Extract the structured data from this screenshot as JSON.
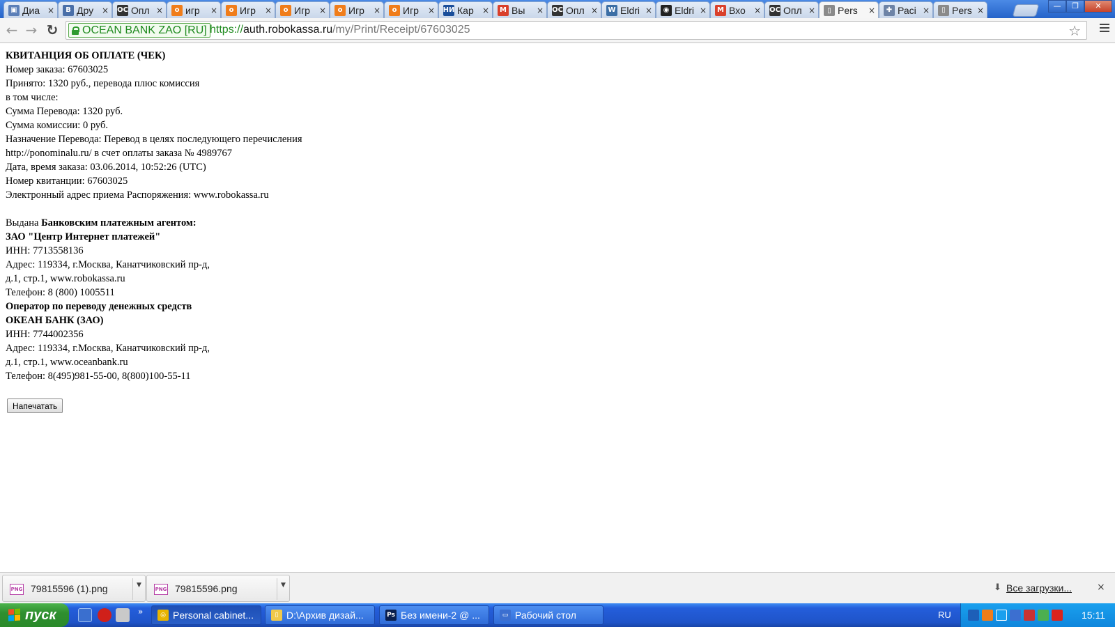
{
  "browser": {
    "tabs": [
      {
        "title": "Диа",
        "fav_color": "#5b7fb8",
        "fav_glyph": "▣"
      },
      {
        "title": "Дру",
        "fav_color": "#4a6fa8",
        "fav_glyph": "B"
      },
      {
        "title": "Опл",
        "fav_color": "#333333",
        "fav_glyph": "ОС"
      },
      {
        "title": "игр",
        "fav_color": "#f07d1a",
        "fav_glyph": "о"
      },
      {
        "title": "Игр",
        "fav_color": "#f07d1a",
        "fav_glyph": "о"
      },
      {
        "title": "Игр",
        "fav_color": "#f07d1a",
        "fav_glyph": "о"
      },
      {
        "title": "Игр",
        "fav_color": "#f07d1a",
        "fav_glyph": "о"
      },
      {
        "title": "Игр",
        "fav_color": "#f07d1a",
        "fav_glyph": "о"
      },
      {
        "title": "Кар",
        "fav_color": "#1a4e9a",
        "fav_glyph": "НИ"
      },
      {
        "title": "Вы",
        "fav_color": "#d9402b",
        "fav_glyph": "M"
      },
      {
        "title": "Опл",
        "fav_color": "#333333",
        "fav_glyph": "ОС"
      },
      {
        "title": "Eldri",
        "fav_color": "#3b6ea5",
        "fav_glyph": "W"
      },
      {
        "title": "Eldri",
        "fav_color": "#222222",
        "fav_glyph": "◉"
      },
      {
        "title": "Вхо",
        "fav_color": "#d9402b",
        "fav_glyph": "M"
      },
      {
        "title": "Опл",
        "fav_color": "#333333",
        "fav_glyph": "ОС"
      },
      {
        "title": "Pers",
        "fav_color": "#8a8a8a",
        "fav_glyph": "▯",
        "active": true
      },
      {
        "title": "Расі",
        "fav_color": "#6d83a6",
        "fav_glyph": "✚"
      },
      {
        "title": "Pers",
        "fav_color": "#8a8a8a",
        "fav_glyph": "▯"
      }
    ],
    "tab_close_glyph": "×",
    "window_buttons": [
      "—",
      "❐",
      "✕"
    ],
    "nav": {
      "back": "←",
      "forward": "→",
      "reload": "↻"
    },
    "address_bar": {
      "ev_label": "OCEAN BANK ZAO [RU]",
      "url_scheme": "https://",
      "url_host": "auth.robokassa.ru",
      "url_path": "/my/Print/Receipt/67603025",
      "star_glyph": "☆"
    }
  },
  "receipt": {
    "lines": [
      {
        "text": "КВИТАНЦИЯ ОБ ОПЛАТЕ (ЧЕК)",
        "bold": true
      },
      {
        "text": "Номер заказа: 67603025"
      },
      {
        "text": "Принято: 1320 руб., перевода плюс комиссия"
      },
      {
        "text": "в том числе:"
      },
      {
        "text": "Сумма Перевода: 1320 руб."
      },
      {
        "text": "Сумма комиссии: 0 руб."
      },
      {
        "text": "Назначение Перевода: Перевод в целях последующего перечисления"
      },
      {
        "text": "http://ponominalu.ru/ в счет оплаты заказа № 4989767"
      },
      {
        "text": "Дата, время заказа: 03.06.2014, 10:52:26 (UTC)"
      },
      {
        "text": "Номер квитанции: 67603025"
      },
      {
        "text": "Электронный адрес приема Распоряжения: www.robokassa.ru"
      },
      {
        "text": ""
      },
      {
        "text": "Выдана ",
        "bold_suffix": "Банковским платежным агентом:"
      },
      {
        "text": "ЗАО \"Центр Интернет платежей\"",
        "bold": true
      },
      {
        "text": "ИНН: 7713558136"
      },
      {
        "text": "Адрес: 119334, г.Москва, Канатчиковский пр-д,"
      },
      {
        "text": "д.1, стр.1, www.robokassa.ru"
      },
      {
        "text": "Телефон: 8 (800) 1005511"
      },
      {
        "text": "Оператор по переводу денежных средств",
        "bold": true
      },
      {
        "text": "ОКЕАН БАНК (ЗАО)",
        "bold": true
      },
      {
        "text": "ИНН: 7744002356"
      },
      {
        "text": "Адрес: 119334, г.Москва, Канатчиковский пр-д,"
      },
      {
        "text": "д.1, стр.1, www.oceanbank.ru"
      },
      {
        "text": "Телефон: 8(495)981-55-00, 8(800)100-55-11"
      }
    ],
    "print_button_label": "Напечатать"
  },
  "downloads": {
    "items": [
      {
        "file_name": "79815596 (1).png",
        "icon_label": "PNG"
      },
      {
        "file_name": "79815596.png",
        "icon_label": "PNG"
      }
    ],
    "all_downloads_label": "Все загрузки...",
    "all_downloads_icon": "⬇",
    "close_glyph": "×"
  },
  "taskbar": {
    "start_label": "пуск",
    "more_glyph": "»",
    "tasks": [
      {
        "label": "Personal cabinet...",
        "icon_color": "#e8b400",
        "icon_glyph": "◎",
        "active": true
      },
      {
        "label": "D:\\Архив дизай...",
        "icon_color": "#f0c94a",
        "icon_glyph": "▯"
      },
      {
        "label": "Без имени-2 @ ...",
        "icon_color": "#0a1f4e",
        "icon_glyph": "Ps"
      },
      {
        "label": "Рабочий стол",
        "icon_color": "#3c6fd0",
        "icon_glyph": "▭"
      }
    ],
    "language": "RU",
    "clock": "15:11"
  }
}
